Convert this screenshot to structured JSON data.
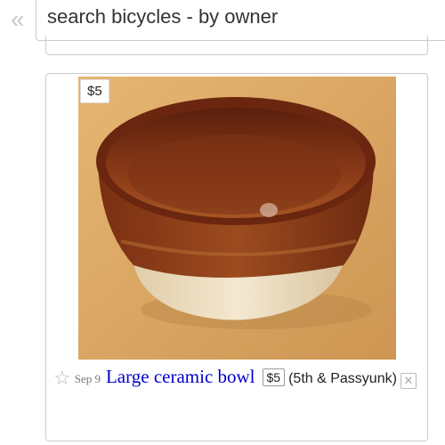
{
  "search": {
    "back_icon": "double-chevron-left-icon",
    "query": "search bicycles - by owner"
  },
  "listing": {
    "price_tag": "$5",
    "favorite_icon": "star-icon",
    "date": "Sep 9",
    "title": "Large ceramic bowl",
    "price": "$5",
    "hood": "(5th & Passyunk)",
    "hide_icon": "trash-icon",
    "photo_description_colors": {
      "background": "#d9a35f",
      "glaze": "#8a3a1a",
      "base": "#efe0c4"
    }
  }
}
